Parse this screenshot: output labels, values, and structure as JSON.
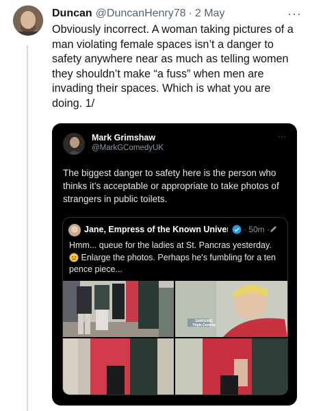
{
  "post": {
    "author_name": "Duncan",
    "author_handle": "@DuncanHenry78",
    "separator": "·",
    "date": "2 May",
    "more_label": "···",
    "text": "Obviously incorrect. A woman taking pictures of a man violating female spaces isn’t a danger to safety anywhere near as much as telling women they shouldn’t make “a fuss” when men are invading their spaces. Which is what you are doing. 1/"
  },
  "embedded_post": {
    "author_name": "Mark Grimshaw",
    "author_handle": "@MarkGComedyUK",
    "more_label": "···",
    "text": "The biggest danger to safety here is the person who thinks it’s acceptable or appropriate to take photos of strangers in public toilets."
  },
  "quoted_post": {
    "author_name": "Jane, Empress of the Known Univers...",
    "time": "· 50m ·",
    "text": "Hmm... queue for the ladies at St. Pancras yesterday.",
    "text_2": "Enlarge the photos. Perhaps he's fumbling for a ten pence piece...",
    "photos": [
      {
        "icon": "photo-queue",
        "overlay_text": ""
      },
      {
        "icon": "photo-person-closeup",
        "overlay_text": "SAMSUNG Triple Camera"
      },
      {
        "icon": "photo-red-coat",
        "overlay_text": ""
      },
      {
        "icon": "photo-red-coat-bag",
        "overlay_text": ""
      }
    ]
  },
  "colors": {
    "verified": "#1d9bf0",
    "background": "#ffffff",
    "screenshot_background": "#000000"
  }
}
